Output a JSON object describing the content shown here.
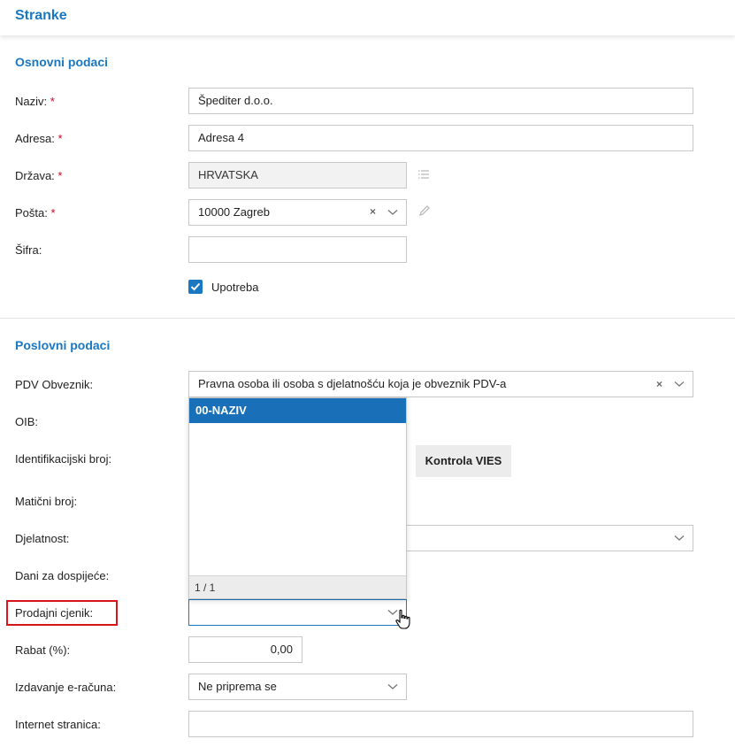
{
  "header": {
    "title": "Stranke"
  },
  "sections": {
    "basic": "Osnovni podaci",
    "business": "Poslovni podaci"
  },
  "fields": {
    "naziv": {
      "label": "Naziv:",
      "value": "Špediter d.o.o."
    },
    "adresa": {
      "label": "Adresa:",
      "value": "Adresa 4"
    },
    "drzava": {
      "label": "Država:",
      "value": "HRVATSKA"
    },
    "posta": {
      "label": "Pošta:",
      "value": "10000 Zagreb"
    },
    "sifra": {
      "label": "Šifra:",
      "value": ""
    },
    "upotreba": {
      "label": "Upotreba",
      "checked": true
    },
    "pdv": {
      "label": "PDV Obveznik:",
      "value": "Pravna osoba ili osoba s djelatnošću koja je obveznik PDV-a"
    },
    "oib": {
      "label": "OIB:"
    },
    "identifikacijski": {
      "label": "Identifikacijski broj:"
    },
    "kontrola_vies": "Kontrola VIES",
    "maticni": {
      "label": "Matični broj:"
    },
    "djelatnost": {
      "label": "Djelatnost:"
    },
    "dani": {
      "label": "Dani za dospijeće:"
    },
    "prodajni_cjenik": {
      "label": "Prodajni cjenik:",
      "value": ""
    },
    "rabat": {
      "label": "Rabat (%):",
      "value": "0,00"
    },
    "izdavanje": {
      "label": "Izdavanje e-računa:",
      "value": "Ne priprema se"
    },
    "internet": {
      "label": "Internet stranica:",
      "value": ""
    }
  },
  "required_marker": "*",
  "clear_glyph": "×",
  "dropdown": {
    "options": [
      "00-NAZIV"
    ],
    "pager": "1 / 1"
  },
  "colors": {
    "accent": "#1a78c2",
    "highlight": "#d8151b"
  },
  "icons": {
    "drzava_side": "list-icon",
    "posta_side": "pencil-icon"
  }
}
